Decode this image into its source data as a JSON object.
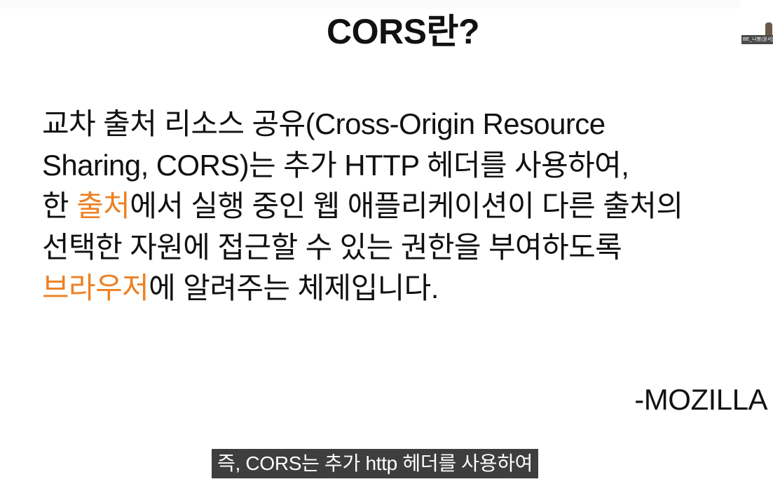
{
  "slide": {
    "title": "CORS란?",
    "body_lines": [
      [
        {
          "text": "교차 출처 리소스 공유(Cross-Origin Resource",
          "highlight": false
        }
      ],
      [
        {
          "text": "Sharing, CORS)는 추가 HTTP 헤더를 사용하여,",
          "highlight": false
        }
      ],
      [
        {
          "text": "한 ",
          "highlight": false
        },
        {
          "text": "출처",
          "highlight": true
        },
        {
          "text": "에서 실행 중인 웹 애플리케이션이 다른 출처의",
          "highlight": false
        }
      ],
      [
        {
          "text": "선택한 자원에 접근할 수 있는 권한을 부여하도록",
          "highlight": false
        }
      ],
      [
        {
          "text": "브라우저",
          "highlight": true
        },
        {
          "text": "에 알려주는 체제입니다.",
          "highlight": false
        }
      ]
    ],
    "attribution": "-MOZILLA"
  },
  "participant": {
    "label": "BE_나봉(윤서)"
  },
  "caption": {
    "text": "즉, CORS는 추가 http 헤더를 사용하여"
  },
  "colors": {
    "background": "#ffffff",
    "text": "#111111",
    "highlight": "#ee8022",
    "caption_background": "#0d0d0d",
    "caption_text": "#ffffff"
  }
}
